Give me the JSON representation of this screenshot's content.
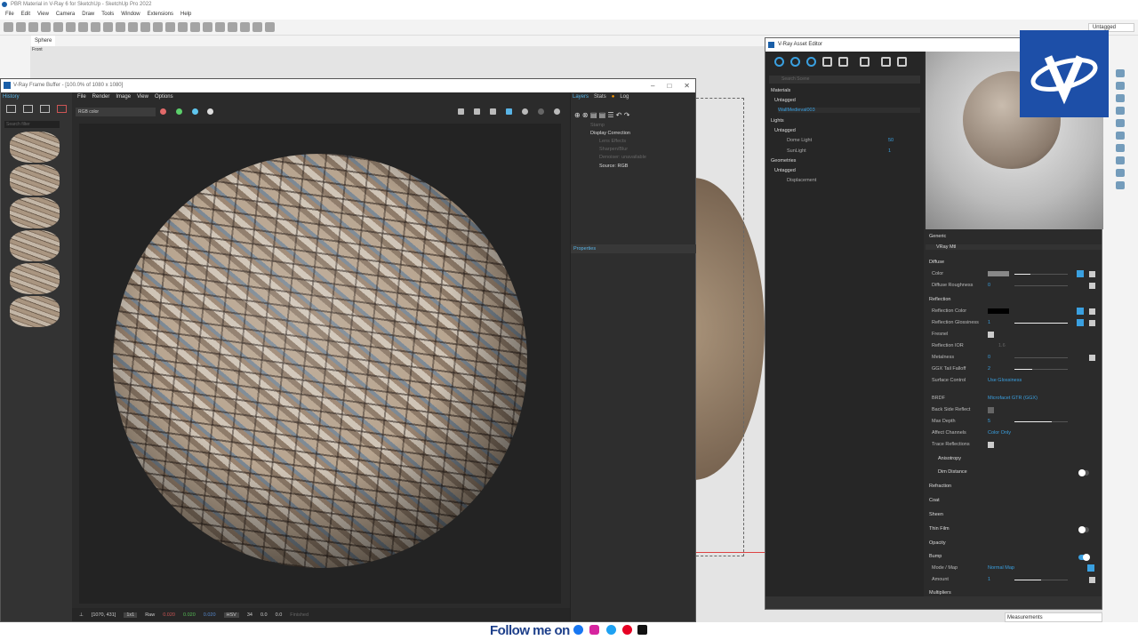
{
  "sketchup": {
    "title": "PBR Material in V-Ray 6 for SketchUp - SketchUp Pro 2022",
    "menu": [
      "File",
      "Edit",
      "View",
      "Camera",
      "Draw",
      "Tools",
      "Window",
      "Extensions",
      "Help"
    ],
    "scene_tab": "Sphere",
    "view_label": "Front",
    "tag_select": "Untagged",
    "measurements": "Measurements"
  },
  "vfb": {
    "title": "V-Ray Frame Buffer - [100.0% of 1080 x 1080]",
    "history_tab": "History",
    "search_placeholder": "Search filter",
    "menu": [
      "File",
      "Render",
      "Image",
      "View",
      "Options"
    ],
    "channel": "RGB color",
    "status": {
      "coords": "[1070, 431]",
      "ratio": "1x1",
      "mode": "Raw",
      "r": "0.020",
      "g": "0.020",
      "b": "0.020",
      "space": "HSV",
      "h": "34",
      "s": "0.0",
      "v": "0.0",
      "state": "Finished"
    },
    "layer_tabs": [
      "Layers",
      "Stats",
      "Log"
    ],
    "layers": [
      "Stamp",
      "Display Correction",
      "Lens Effects",
      "Sharpen/Blur",
      "Denoiser: unavailable",
      "Source: RGB"
    ],
    "properties": "Properties"
  },
  "asset_editor": {
    "title": "V-Ray Asset Editor",
    "search_placeholder": "Search Scene",
    "tree": {
      "materials": "Materials",
      "mat_tag": "Untagged",
      "material": "WallMedieval003",
      "lights": "Lights",
      "light_tag": "Untagged",
      "dome": "Dome Light",
      "dome_val": "50",
      "sun": "SunLight",
      "sun_val": "1",
      "geometries": "Geometries",
      "geo_tag": "Untagged",
      "displacement": "Displacement"
    },
    "generic": "Generic",
    "mtl": "VRay Mtl",
    "diffuse": {
      "label": "Diffuse",
      "color": "Color",
      "roughness": "Diffuse Roughness",
      "roughness_val": "0"
    },
    "reflection": {
      "label": "Reflection",
      "color": "Reflection Color",
      "gloss": "Reflection Glossiness",
      "gloss_val": "1",
      "fresnel": "Fresnel",
      "ior": "Reflection IOR",
      "ior_val": "1.6",
      "metal": "Metalness",
      "metal_val": "0",
      "ggx": "GGX Tail Falloff",
      "ggx_val": "2",
      "surface": "Surface Control",
      "surface_val": "Use Glossiness",
      "brdf": "BRDF",
      "brdf_val": "Microfacet GTR (GGX)",
      "backside": "Back Side Reflect",
      "depth": "Max Depth",
      "depth_val": "5",
      "affect": "Affect Channels",
      "affect_val": "Color Only",
      "trace": "Trace Reflections",
      "aniso": "Anisotropy",
      "dim": "Dim Distance"
    },
    "sections": [
      "Refraction",
      "Coat",
      "Sheen",
      "Thin Film",
      "Opacity"
    ],
    "bump": {
      "label": "Bump",
      "mode": "Mode / Map",
      "mode_val": "Normal Map",
      "amount": "Amount",
      "amount_val": "1"
    },
    "multipliers": "Multipliers"
  },
  "footer": {
    "follow": "Follow me on"
  }
}
